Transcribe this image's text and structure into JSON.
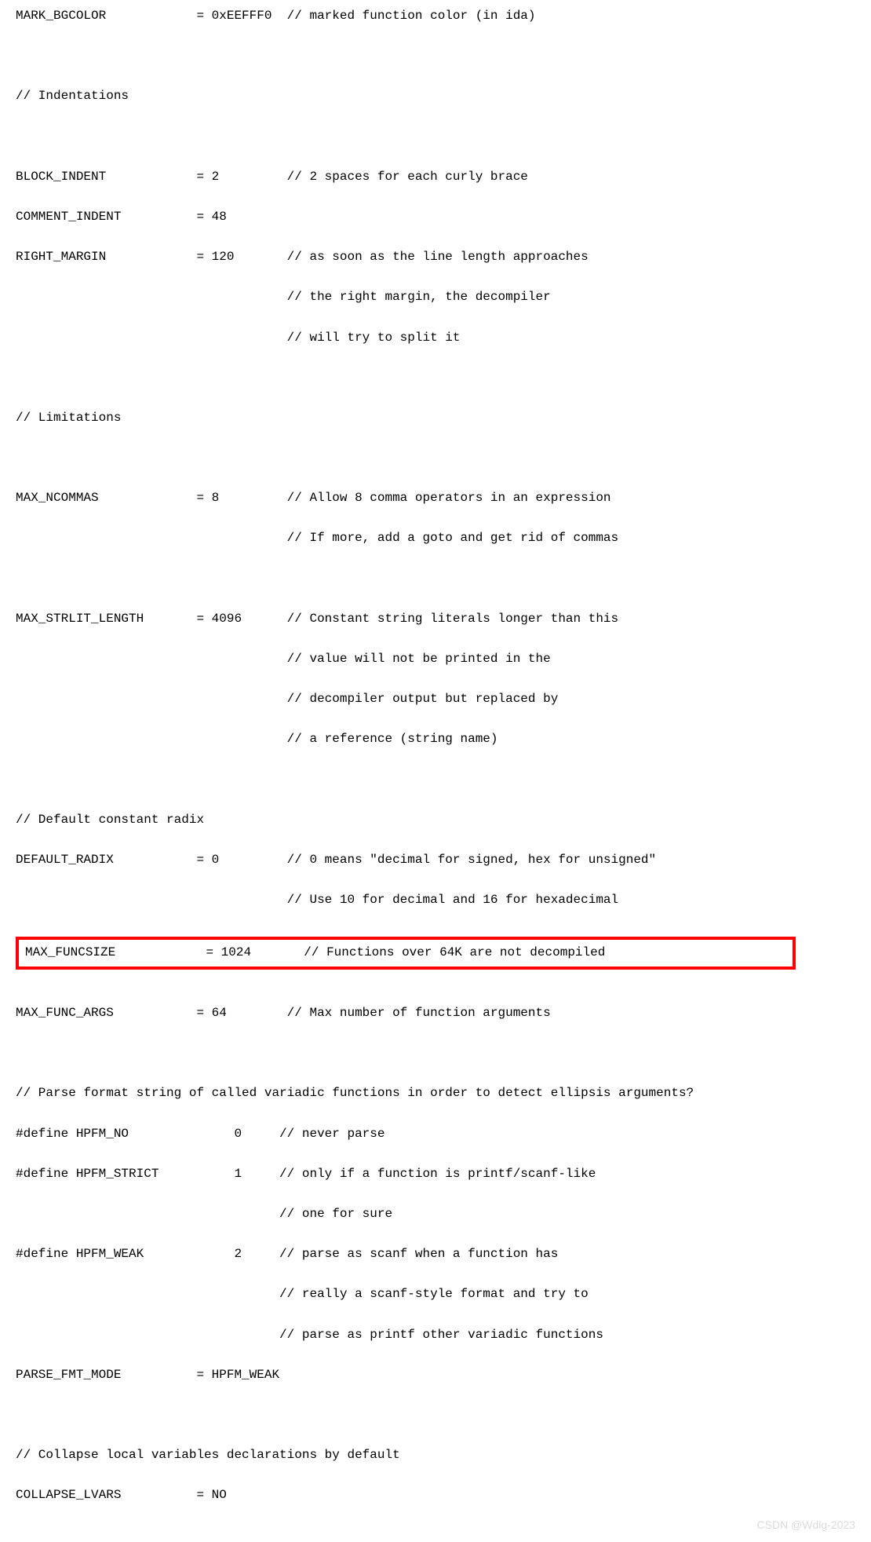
{
  "lines": {
    "l01": "MARK_BGCOLOR            = 0xEEFFF0  // marked function color (in ida)",
    "l02": "",
    "l03": "// Indentations",
    "l04": "",
    "l05": "BLOCK_INDENT            = 2         // 2 spaces for each curly brace",
    "l06": "COMMENT_INDENT          = 48",
    "l07": "RIGHT_MARGIN            = 120       // as soon as the line length approaches",
    "l08": "                                    // the right margin, the decompiler",
    "l09": "                                    // will try to split it",
    "l10": "",
    "l11": "// Limitations",
    "l12": "",
    "l13": "MAX_NCOMMAS             = 8         // Allow 8 comma operators in an expression",
    "l14": "                                    // If more, add a goto and get rid of commas",
    "l15": "",
    "l16": "MAX_STRLIT_LENGTH       = 4096      // Constant string literals longer than this",
    "l17": "                                    // value will not be printed in the",
    "l18": "                                    // decompiler output but replaced by",
    "l19": "                                    // a reference (string name)",
    "l20": "",
    "l21": "// Default constant radix",
    "l22": "DEFAULT_RADIX           = 0         // 0 means \"decimal for signed, hex for unsigned\"",
    "l23": "                                    // Use 10 for decimal and 16 for hexadecimal",
    "l24_highlight": "MAX_FUNCSIZE            = 1024       // Functions over 64K are not decompiled",
    "l25": "",
    "l26": "MAX_FUNC_ARGS           = 64        // Max number of function arguments",
    "l27": "",
    "l28": "// Parse format string of called variadic functions in order to detect ellipsis arguments?",
    "l29": "#define HPFM_NO              0     // never parse",
    "l30": "#define HPFM_STRICT          1     // only if a function is printf/scanf-like",
    "l31": "                                   // one for sure",
    "l32": "#define HPFM_WEAK            2     // parse as scanf when a function has",
    "l33": "                                   // really a scanf-style format and try to",
    "l34": "                                   // parse as printf other variadic functions",
    "l35": "PARSE_FMT_MODE          = HPFM_WEAK",
    "l36": "",
    "l37": "// Collapse local variables declarations by default",
    "l38": "COLLAPSE_LVARS          = NO"
  },
  "watermark": "CSDN @Wdlg-2023"
}
